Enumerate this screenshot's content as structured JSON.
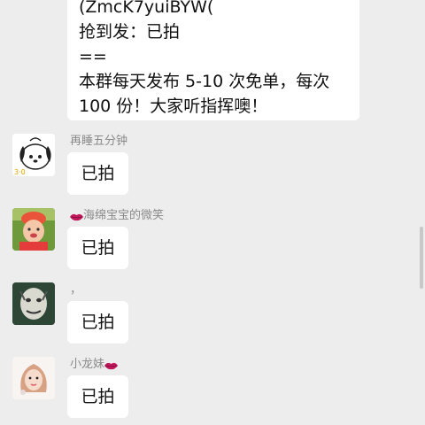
{
  "top_message": {
    "lines": [
      "(ZmcK7yuiBYW(",
      "抢到发：已拍",
      "==",
      "本群每天发布 5-10 次免单，每次",
      "100 份！大家听指挥噢！"
    ]
  },
  "messages": [
    {
      "sender": "再睡五分钟",
      "text": "已拍",
      "avatar": "cartoon-dog-avatar"
    },
    {
      "sender": "海绵宝宝的微笑",
      "text": "已拍",
      "avatar": "baby-photo-avatar",
      "prefix_icon": "lips-icon"
    },
    {
      "sender": "，",
      "text": "已拍",
      "avatar": "meme-face-avatar"
    },
    {
      "sender": "小龙妹",
      "text": "已拍",
      "avatar": "girl-photo-avatar",
      "suffix_icon": "lips-icon"
    }
  ],
  "colors": {
    "background": "#ededed",
    "bubble": "#ffffff",
    "sender_name": "#8a8a8a",
    "lips": "#c2185b"
  }
}
